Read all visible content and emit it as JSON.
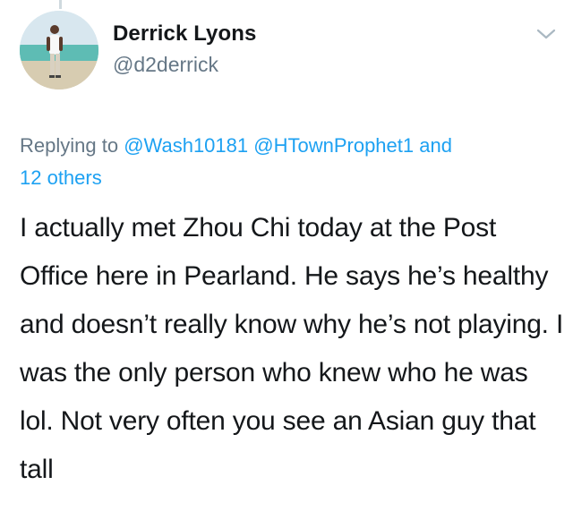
{
  "user": {
    "display_name": "Derrick Lyons",
    "handle": "@d2derrick"
  },
  "replying": {
    "prefix": "Replying to ",
    "mentions": [
      "@Wash10181",
      "@HTownProphet1"
    ],
    "suffix": " and",
    "others": "12 others"
  },
  "tweet": {
    "text": "I actually met Zhou Chi today at the Post Office here in Pearland. He says he’s healthy and doesn’t really know why he’s not playing. I was the only person who knew who he was lol. Not very often you see an Asian guy that tall"
  },
  "icons": {
    "menu": "chevron-down-icon"
  },
  "colors": {
    "name": "#14171a",
    "secondary": "#657786",
    "link": "#1da1f2"
  }
}
